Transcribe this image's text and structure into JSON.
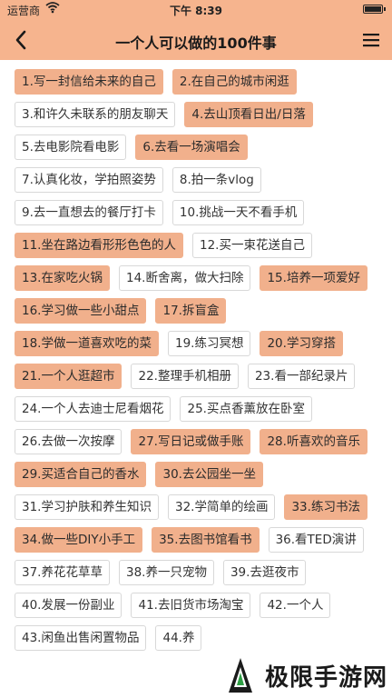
{
  "status_bar": {
    "carrier": "运营商",
    "time": "下午 8:39"
  },
  "header": {
    "title": "一个人可以做的100件事"
  },
  "icons": {
    "back": "chevron-left-icon",
    "menu": "hamburger-menu-icon",
    "wifi": "wifi-icon",
    "battery": "battery-icon"
  },
  "colors": {
    "header_bg": "#f6b48e",
    "done_tag_bg": "#f1b08c",
    "tag_border": "#d8d8d8"
  },
  "items": [
    {
      "label": "1.写一封信给未来的自己",
      "done": true
    },
    {
      "label": "2.在自己的城市闲逛",
      "done": true
    },
    {
      "label": "3.和许久未联系的朋友聊天",
      "done": false
    },
    {
      "label": "4.去山顶看日出/日落",
      "done": true
    },
    {
      "label": "5.去电影院看电影",
      "done": false
    },
    {
      "label": "6.去看一场演唱会",
      "done": true
    },
    {
      "label": "7.认真化妆，学拍照姿势",
      "done": false
    },
    {
      "label": "8.拍一条vlog",
      "done": false
    },
    {
      "label": "9.去一直想去的餐厅打卡",
      "done": false
    },
    {
      "label": "10.挑战一天不看手机",
      "done": false
    },
    {
      "label": "11.坐在路边看形形色色的人",
      "done": true
    },
    {
      "label": "12.买一束花送自己",
      "done": false
    },
    {
      "label": "13.在家吃火锅",
      "done": true
    },
    {
      "label": "14.断舍离，做大扫除",
      "done": false
    },
    {
      "label": "15.培养一项爱好",
      "done": true
    },
    {
      "label": "16.学习做一些小甜点",
      "done": true
    },
    {
      "label": "17.拆盲盒",
      "done": true
    },
    {
      "label": "18.学做一道喜欢吃的菜",
      "done": true
    },
    {
      "label": "19.练习冥想",
      "done": false
    },
    {
      "label": "20.学习穿搭",
      "done": true
    },
    {
      "label": "21.一个人逛超市",
      "done": true
    },
    {
      "label": "22.整理手机相册",
      "done": false
    },
    {
      "label": "23.看一部纪录片",
      "done": false
    },
    {
      "label": "24.一个人去迪士尼看烟花",
      "done": false
    },
    {
      "label": "25.买点香薰放在卧室",
      "done": false
    },
    {
      "label": "26.去做一次按摩",
      "done": false
    },
    {
      "label": "27.写日记或做手账",
      "done": true
    },
    {
      "label": "28.听喜欢的音乐",
      "done": true
    },
    {
      "label": "29.买适合自己的香水",
      "done": true
    },
    {
      "label": "30.去公园坐一坐",
      "done": true
    },
    {
      "label": "31.学习护肤和养生知识",
      "done": false
    },
    {
      "label": "32.学简单的绘画",
      "done": false
    },
    {
      "label": "33.练习书法",
      "done": true
    },
    {
      "label": "34.做一些DIY小手工",
      "done": true
    },
    {
      "label": "35.去图书馆看书",
      "done": true
    },
    {
      "label": "36.看TED演讲",
      "done": false
    },
    {
      "label": "37.养花花草草",
      "done": false
    },
    {
      "label": "38.养一只宠物",
      "done": false
    },
    {
      "label": "39.去逛夜市",
      "done": false
    },
    {
      "label": "40.发展一份副业",
      "done": false
    },
    {
      "label": "41.去旧货市场淘宝",
      "done": false
    },
    {
      "label": "42.一个人",
      "done": false
    },
    {
      "label": "43.闲鱼出售闲置物品",
      "done": false
    },
    {
      "label": "44.养",
      "done": false
    }
  ],
  "watermark": {
    "text": "极限手游网"
  }
}
